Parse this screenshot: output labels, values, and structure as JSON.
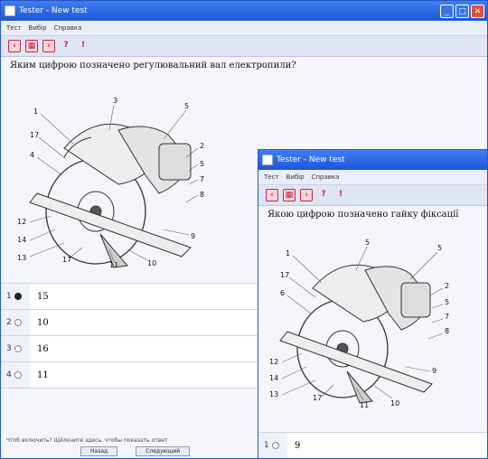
{
  "main_window": {
    "title": "Tester - New test",
    "menu": [
      "Тест",
      "Вибір",
      "Справка"
    ],
    "toolbar_tools": [
      "prev-icon",
      "grid-icon",
      "next-icon",
      "help-icon",
      "info-icon"
    ],
    "question": "Яким цифрою позначено регулювальний вал електропили?",
    "diagram_labels": [
      "1",
      "3",
      "5",
      "17",
      "4",
      "2",
      "5",
      "7",
      "8",
      "12",
      "14",
      "13",
      "17",
      "11",
      "10",
      "9"
    ],
    "answers": [
      {
        "num": "1",
        "value": "15",
        "selected": true
      },
      {
        "num": "2",
        "value": "10",
        "selected": false
      },
      {
        "num": "3",
        "value": "16",
        "selected": false
      },
      {
        "num": "4",
        "value": "11",
        "selected": false
      }
    ],
    "status": "Чтоб включить? Щёлкните здесь, чтобы показать ответ",
    "buttons": [
      "Назад",
      "Следующий"
    ]
  },
  "second_window": {
    "title": "Tester - New test",
    "menu": [
      "Тест",
      "Вибір",
      "Справка"
    ],
    "question": "Якою цифрою позначено гайку фіксації",
    "diagram_labels": [
      "1",
      "5",
      "5",
      "17",
      "6",
      "2",
      "5",
      "7",
      "8",
      "12",
      "14",
      "13",
      "17",
      "11",
      "10",
      "9"
    ],
    "answers": [
      {
        "num": "1",
        "value": "9",
        "selected": false
      }
    ]
  },
  "colors": {
    "title_bar": "#1f55d8",
    "close_button": "#e0533a",
    "window_border": "#2a56c6"
  }
}
